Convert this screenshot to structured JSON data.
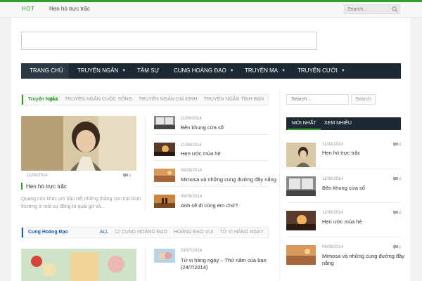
{
  "topbar": {
    "hot_label": "HOT",
    "ticker_text": "Hẹn hò trực trặc",
    "search_placeholder": "Search..."
  },
  "nav": {
    "items": [
      {
        "label": "TRANG CHỦ",
        "dropdown": false,
        "active": true
      },
      {
        "label": "TRUYỆN NGẮN",
        "dropdown": true
      },
      {
        "label": "TÂM SỰ",
        "dropdown": false
      },
      {
        "label": "CUNG HOÀNG ĐẠO",
        "dropdown": true
      },
      {
        "label": "TRUYỆN MA",
        "dropdown": true
      },
      {
        "label": "TRUYỆN CƯỜI",
        "dropdown": true
      }
    ]
  },
  "section1": {
    "title": "Truyện Ngắn",
    "title_color": "#2ca02c",
    "tabs": [
      "ALL",
      "TRUYỆN NGẮN CUỘC SỐNG",
      "TRUYỆN NGẮN GIA ĐÌNH",
      "TRUYỆN NGẮN TÌNH BẠN"
    ],
    "featured": {
      "date": "11/08/2014",
      "comments": "0",
      "title": "Hẹn hò trực trặc",
      "excerpt": "Quang còn khác với hầu hết những thằng con trai bình thường ở một sự đồng tri quái gở và..."
    },
    "list": [
      {
        "date": "11/08/2014",
        "title": "Bên khung cửa sổ"
      },
      {
        "date": "11/08/2014",
        "title": "Hẹn ước mùa hè"
      },
      {
        "date": "08/08/2014",
        "title": "Mimosa và những cung đường đầy nắng"
      },
      {
        "date": "08/08/2014",
        "title": "Anh sẽ đi cùng em chứ?"
      }
    ]
  },
  "section2": {
    "title": "Cung Hoàng Đạo",
    "title_color": "#1a5fb4",
    "tabs": [
      "ALL",
      "12 CUNG HOÀNG ĐẠO",
      "HOÀNG ĐẠO VUI",
      "TỬ VI HÀNG NGÀY"
    ],
    "list": [
      {
        "date": "24/07/2014",
        "title_line1": "Tử vi hàng ngày – Thứ năm của bạn",
        "title_line2": "(24/7/2014)"
      }
    ]
  },
  "sidebar": {
    "search_placeholder": "Search ...",
    "search_button": "Search",
    "tabs": [
      "MỚI NHẤT",
      "XEM NHIỀU"
    ],
    "posts": [
      {
        "date": "11/08/2014",
        "title": "Hẹn hò trực trặc",
        "comments": "0"
      },
      {
        "date": "11/08/2014",
        "title": "Bên khung cửa sổ",
        "comments": "0"
      },
      {
        "date": "11/08/2014",
        "title": "Hẹn ước mùa hè",
        "comments": "0"
      },
      {
        "date": "08/08/2014",
        "title_line1": "Mimosa và những cung đường đầy",
        "title_line2": "nắng",
        "comments": "0"
      }
    ]
  },
  "colors": {
    "accent": "#2ca02c",
    "nav_bg": "#1e2a33",
    "blue_title": "#1a5fb4"
  }
}
